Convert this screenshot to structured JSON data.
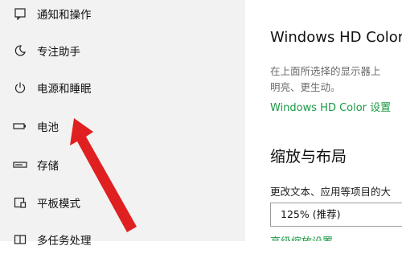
{
  "sidebar": {
    "items": [
      {
        "label": "通知和操作",
        "icon": "notification-icon"
      },
      {
        "label": "专注助手",
        "icon": "moon-icon"
      },
      {
        "label": "电源和睡眠",
        "icon": "power-icon"
      },
      {
        "label": "电池",
        "icon": "battery-icon"
      },
      {
        "label": "存储",
        "icon": "storage-icon"
      },
      {
        "label": "平板模式",
        "icon": "tablet-mode-icon"
      },
      {
        "label": "多任务处理",
        "icon": "multitasking-icon"
      }
    ]
  },
  "main": {
    "hdr_title": "Windows HD Color",
    "desc_line1": "在上面所选择的显示器上",
    "desc_line2": "明亮、更生动。",
    "hdr_link": "Windows HD Color 设置",
    "scale_title": "缩放与布局",
    "scale_desc": "更改文本、应用等项目的大",
    "scale_value": "125% (推荐)",
    "advanced_link": "高级缩放设置"
  },
  "colors": {
    "accent_green": "#1a9a43",
    "arrow_red": "#e02020",
    "sidebar_bg": "#f2f2f2"
  }
}
